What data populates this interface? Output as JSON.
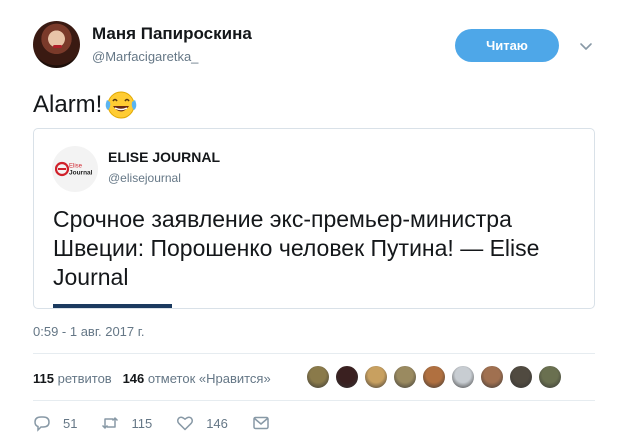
{
  "tweet": {
    "author": {
      "display_name": "Маня Папироскина",
      "handle": "@Marfacigaretka_"
    },
    "follow_label": "Читаю",
    "text": "Alarm!",
    "emoji_icon": "face-with-tears-of-joy-icon",
    "timestamp": "0:59 - 1 авг. 2017 г."
  },
  "card": {
    "logo_text_top": "Elise",
    "logo_text_bottom": "Journal",
    "name": "ELISE JOURNAL",
    "handle": "@elisejournal",
    "title": "Срочное заявление экс-премьер-министра Швеции: Порошенко  человек Путина! — Elise Journal"
  },
  "stats": {
    "retweets_count": "115",
    "retweets_label": "ретвитов",
    "likes_count": "146",
    "likes_label": "отметок «Нравится»",
    "liker_colors": [
      "#8a7a4a",
      "#3a2020",
      "#c8a060",
      "#9a8a60",
      "#b07040",
      "#c8cdd2",
      "#a07050",
      "#504a40",
      "#6a7050"
    ]
  },
  "actions": {
    "reply_count": "51",
    "retweet_count": "115",
    "like_count": "146"
  },
  "colors": {
    "accent": "#4ea7e8",
    "muted": "#657786",
    "border": "#e6ecf0"
  }
}
